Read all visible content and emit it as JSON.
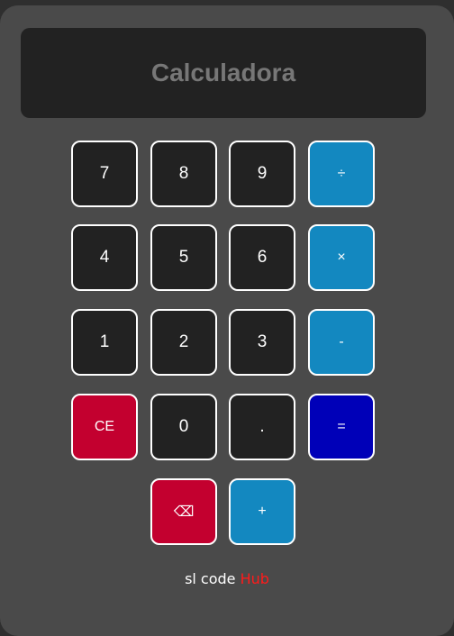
{
  "display": {
    "title": "Calculadora"
  },
  "buttons": {
    "seven": "7",
    "eight": "8",
    "nine": "9",
    "divide": "÷",
    "four": "4",
    "five": "5",
    "six": "6",
    "multiply": "×",
    "one": "1",
    "two": "2",
    "three": "3",
    "minus": "-",
    "clear": "CE",
    "zero": "0",
    "decimal": ".",
    "equals": "=",
    "backspace": "⌫",
    "plus": "+"
  },
  "footer": {
    "prefix": "sl code ",
    "accent": "Hub"
  },
  "colors": {
    "body": "#4a4a4a",
    "display": "#222222",
    "operator": "#1388c0",
    "danger": "#c3002f",
    "equals": "#0000b8",
    "footer_accent": "#ff1a1a"
  }
}
